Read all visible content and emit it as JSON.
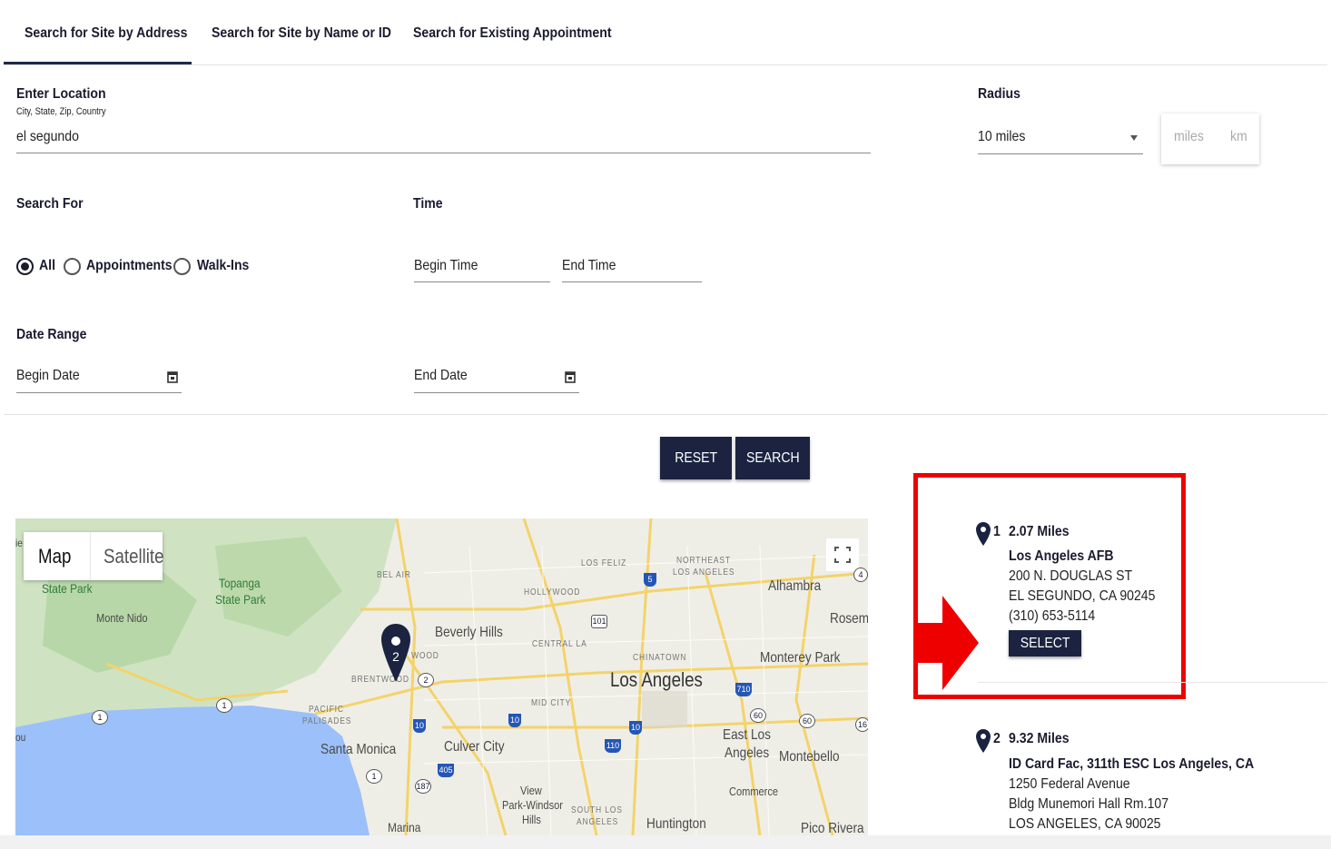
{
  "tabs": [
    {
      "label": "Search for Site by Address"
    },
    {
      "label": "Search for Site by Name or ID"
    },
    {
      "label": "Search for Existing Appointment"
    }
  ],
  "location": {
    "label": "Enter Location",
    "hint": "City, State, Zip, Country",
    "value": "el segundo"
  },
  "radius": {
    "label": "Radius",
    "value": "10 miles",
    "unit_miles": "miles",
    "unit_km": "km"
  },
  "search_for": {
    "label": "Search For",
    "options": [
      "All",
      "Appointments",
      "Walk-Ins"
    ],
    "selected": "All"
  },
  "time": {
    "label": "Time",
    "begin_placeholder": "Begin Time",
    "end_placeholder": "End Time"
  },
  "date_range": {
    "label": "Date Range",
    "begin_placeholder": "Begin Date",
    "end_placeholder": "End Date"
  },
  "buttons": {
    "reset": "RESET",
    "search": "SEARCH"
  },
  "map": {
    "type_map": "Map",
    "type_satellite": "Satellite",
    "pin_number": "2",
    "labels": {
      "state_park": "State Park",
      "topanga": "Topanga",
      "topanga_sp": "State Park",
      "monte_nido": "Monte Nido",
      "bel_air": "BEL AIR",
      "hollywood": "HOLLYWOOD",
      "los_feliz": "LOS FELIZ",
      "northeast": "NORTHEAST",
      "northeast_la": "LOS ANGELES",
      "alhambra": "Alhambra",
      "rosem": "Rosem",
      "beverly_hills": "Beverly Hills",
      "central_la": "CENTRAL LA",
      "chinatown": "CHINATOWN",
      "monterey_park": "Monterey Park",
      "los_angeles": "Los Angeles",
      "brentwood": "BRENTWOOD",
      "wood": "WOOD",
      "pacific": "PACIFIC",
      "palisades": "PALISADES",
      "mid_city": "MID CITY",
      "east_la_1": "East Los",
      "east_la_2": "Angeles",
      "montebello": "Montebello",
      "santa_monica": "Santa Monica",
      "culver_city": "Culver City",
      "commerce": "Commerce",
      "view_park": "View",
      "park_windsor": "Park-Windsor",
      "hills": "Hills",
      "south_la_1": "SOUTH LOS",
      "south_la_2": "ANGELES",
      "huntington": "Huntington",
      "pico_rivera": "Pico Rivera",
      "marina": "Marina",
      "ou": "ou",
      "ie": "ie"
    },
    "shields": [
      "101",
      "5",
      "10",
      "10",
      "10",
      "110",
      "710",
      "60",
      "60",
      "405",
      "187",
      "1",
      "1",
      "1",
      "2",
      "4",
      "16"
    ]
  },
  "results": [
    {
      "number": "1",
      "distance": "2.07 Miles",
      "name": "Los Angeles AFB",
      "lines": [
        "200 N. DOUGLAS ST",
        "EL SEGUNDO, CA 90245",
        "(310) 653-5114"
      ],
      "select_label": "SELECT"
    },
    {
      "number": "2",
      "distance": "9.32 Miles",
      "name": "ID Card Fac, 311th ESC Los Angeles, CA",
      "lines": [
        "1250 Federal Avenue",
        "Bldg Munemori Hall Rm.107",
        "LOS ANGELES, CA 90025"
      ]
    }
  ],
  "colors": {
    "navy": "#1b2340",
    "highlight": "#ee0000",
    "water": "#9cc0f9"
  }
}
